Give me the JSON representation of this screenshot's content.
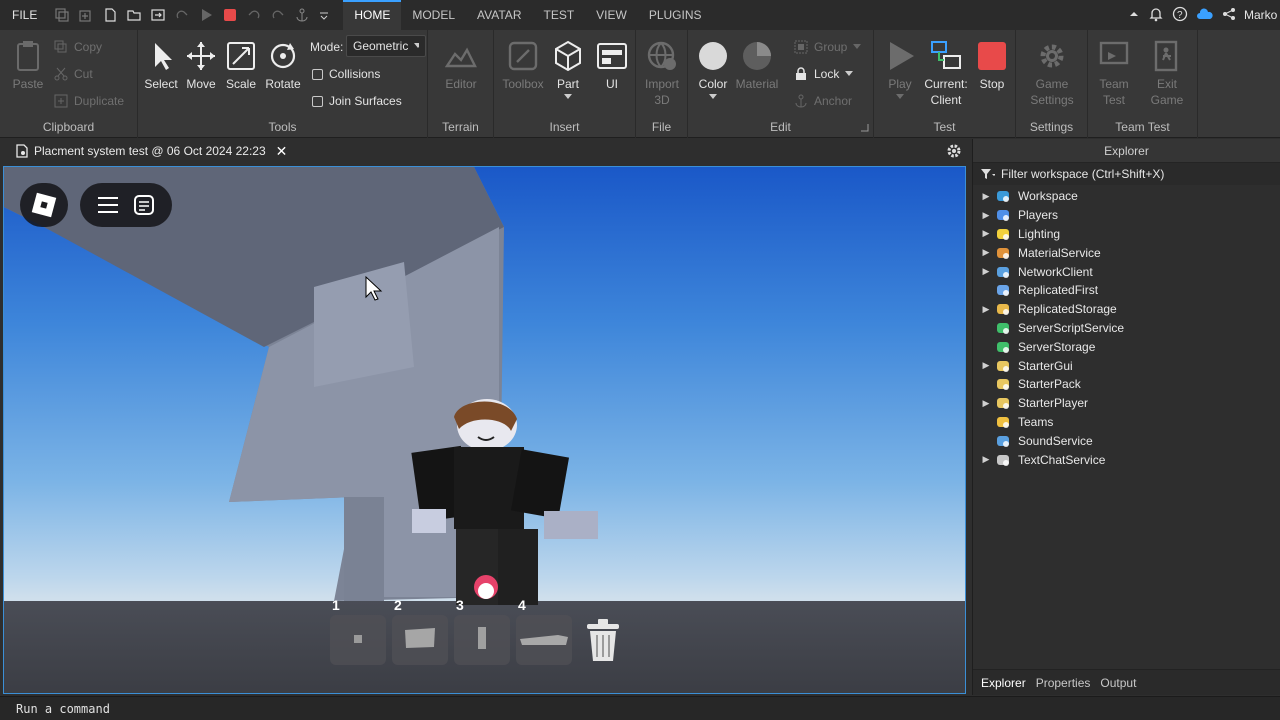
{
  "menubar": {
    "file": "FILE",
    "tabs": [
      {
        "label": "HOME",
        "active": true
      },
      {
        "label": "MODEL",
        "active": false
      },
      {
        "label": "AVATAR",
        "active": false
      },
      {
        "label": "TEST",
        "active": false
      },
      {
        "label": "VIEW",
        "active": false
      },
      {
        "label": "PLUGINS",
        "active": false
      }
    ],
    "username": "Marko"
  },
  "ribbon": {
    "clipboard": {
      "label": "Clipboard",
      "paste": "Paste",
      "copy": "Copy",
      "cut": "Cut",
      "duplicate": "Duplicate"
    },
    "tools": {
      "label": "Tools",
      "select": "Select",
      "move": "Move",
      "scale": "Scale",
      "rotate": "Rotate",
      "mode_label": "Mode:",
      "mode_value": "Geometric",
      "collisions": "Collisions",
      "join_surfaces": "Join Surfaces"
    },
    "terrain": {
      "label": "Terrain",
      "editor": "Editor"
    },
    "insert": {
      "label": "Insert",
      "toolbox": "Toolbox",
      "part": "Part",
      "ui": "UI"
    },
    "file": {
      "label": "File",
      "import3d_line1": "Import",
      "import3d_line2": "3D"
    },
    "edit": {
      "label": "Edit",
      "color": "Color",
      "material": "Material",
      "group": "Group",
      "lock": "Lock",
      "anchor": "Anchor"
    },
    "test": {
      "label": "Test",
      "play": "Play",
      "current_line1": "Current:",
      "current_line2": "Client",
      "stop": "Stop"
    },
    "settings": {
      "label": "Settings",
      "game_settings_line1": "Game",
      "game_settings_line2": "Settings"
    },
    "team_test": {
      "label": "Team Test",
      "team_test_line1": "Team",
      "team_test_line2": "Test",
      "exit_line1": "Exit",
      "exit_line2": "Game"
    }
  },
  "document": {
    "tab_title": "Placment system test @ 06 Oct 2024 22:23"
  },
  "viewport": {
    "hotbar": [
      {
        "number": "1"
      },
      {
        "number": "2"
      },
      {
        "number": "3"
      },
      {
        "number": "4"
      }
    ]
  },
  "explorer": {
    "title": "Explorer",
    "filter_placeholder": "Filter workspace (Ctrl+Shift+X)",
    "items": [
      {
        "label": "Workspace",
        "expandable": true,
        "icon": "globe-icon",
        "color": "#3a9ad9"
      },
      {
        "label": "Players",
        "expandable": true,
        "icon": "players-icon",
        "color": "#4f8fe8"
      },
      {
        "label": "Lighting",
        "expandable": true,
        "icon": "bulb-icon",
        "color": "#f2d13c"
      },
      {
        "label": "MaterialService",
        "expandable": true,
        "icon": "material-icon",
        "color": "#e0923a"
      },
      {
        "label": "NetworkClient",
        "expandable": true,
        "icon": "network-icon",
        "color": "#5aa0e0"
      },
      {
        "label": "ReplicatedFirst",
        "expandable": false,
        "icon": "replicated-first-icon",
        "color": "#6aa4e8"
      },
      {
        "label": "ReplicatedStorage",
        "expandable": true,
        "icon": "storage-icon",
        "color": "#e8b84a"
      },
      {
        "label": "ServerScriptService",
        "expandable": false,
        "icon": "server-script-icon",
        "color": "#3fbf6a"
      },
      {
        "label": "ServerStorage",
        "expandable": false,
        "icon": "server-storage-icon",
        "color": "#3fbf6a"
      },
      {
        "label": "StarterGui",
        "expandable": true,
        "icon": "folder-icon",
        "color": "#e8c760"
      },
      {
        "label": "StarterPack",
        "expandable": false,
        "icon": "folder-icon",
        "color": "#e8c760"
      },
      {
        "label": "StarterPlayer",
        "expandable": true,
        "icon": "folder-icon",
        "color": "#e8c760"
      },
      {
        "label": "Teams",
        "expandable": false,
        "icon": "teams-icon",
        "color": "#f0c040"
      },
      {
        "label": "SoundService",
        "expandable": false,
        "icon": "sound-icon",
        "color": "#5aa0e0"
      },
      {
        "label": "TextChatService",
        "expandable": true,
        "icon": "chat-icon",
        "color": "#c8c8c8"
      }
    ],
    "bottom_tabs": [
      {
        "label": "Explorer",
        "active": true
      },
      {
        "label": "Properties",
        "active": false
      },
      {
        "label": "Output",
        "active": false
      }
    ]
  },
  "command_bar": {
    "placeholder": "Run a command"
  },
  "colors": {
    "accent": "#3aa0ff",
    "stop": "#e84a4a",
    "sky_top": "#1a58c8"
  }
}
